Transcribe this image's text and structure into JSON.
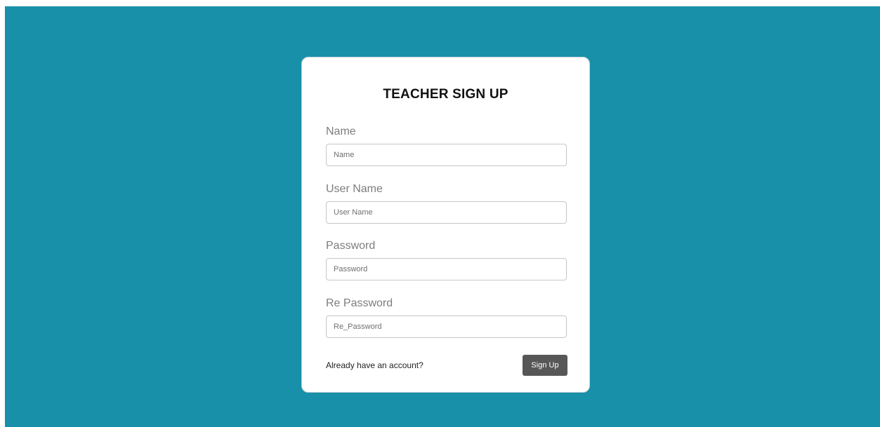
{
  "form": {
    "title": "TEACHER SIGN UP",
    "fields": [
      {
        "label": "Name",
        "placeholder": "Name"
      },
      {
        "label": "User Name",
        "placeholder": "User Name"
      },
      {
        "label": "Password",
        "placeholder": "Password"
      },
      {
        "label": "Re Password",
        "placeholder": "Re_Password"
      }
    ],
    "footer_text": "Already have an account?",
    "submit_label": "Sign Up"
  },
  "colors": {
    "background": "#1890a9",
    "card": "#ffffff",
    "button": "#575757"
  }
}
